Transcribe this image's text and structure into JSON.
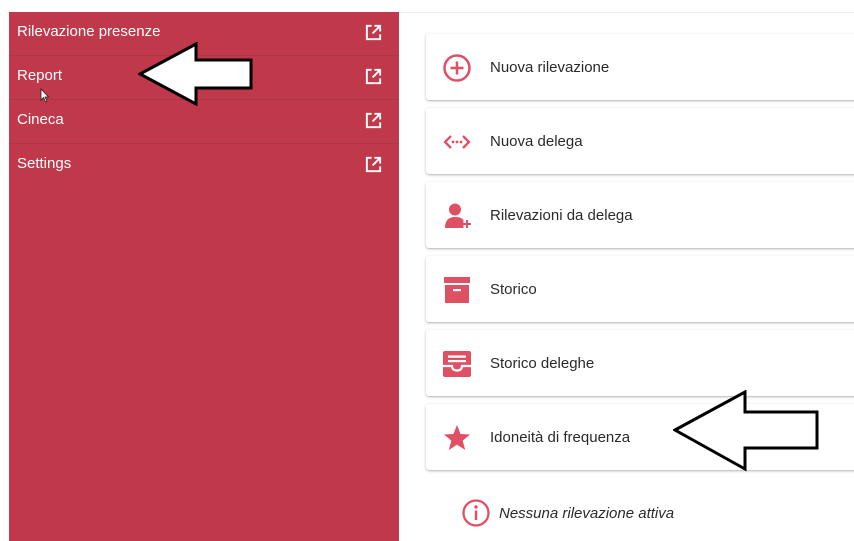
{
  "sidebar": {
    "items": [
      {
        "label": "Rilevazione presenze",
        "icon": "external-link-icon"
      },
      {
        "label": "Report",
        "icon": "external-link-icon"
      },
      {
        "label": "Cineca",
        "icon": "external-link-icon"
      },
      {
        "label": "Settings",
        "icon": "external-link-icon"
      }
    ]
  },
  "main": {
    "cards": [
      {
        "label": "Nuova rilevazione",
        "icon": "plus-circle-icon"
      },
      {
        "label": "Nuova delega",
        "icon": "code-arrows-icon"
      },
      {
        "label": "Rilevazioni da delega",
        "icon": "person-add-icon"
      },
      {
        "label": "Storico",
        "icon": "archive-icon"
      },
      {
        "label": "Storico deleghe",
        "icon": "inbox-icon"
      },
      {
        "label": "Idoneità di frequenza",
        "icon": "star-icon"
      }
    ],
    "status": {
      "label": "Nessuna rilevazione attiva",
      "icon": "info-icon"
    }
  },
  "colors": {
    "sidebar_bg": "#c0394a",
    "accent": "#e05065",
    "text": "#2a2a2a"
  }
}
